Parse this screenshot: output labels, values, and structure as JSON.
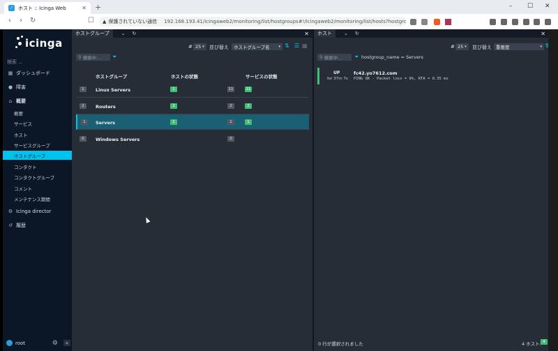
{
  "browser": {
    "tab_title": "ホスト :: Icinga Web",
    "new_tab": "+",
    "security_warning": "保護されていない通信",
    "url": "192.168.193.41/icingaweb2/monitoring/list/hostgroups#!/icingaweb2/monitoring/list/hosts?hostgroup_nam...",
    "window_minimize": "–",
    "window_maximize": "☐",
    "window_close": "✕",
    "back": "‹",
    "forward": "›",
    "reload": "↻",
    "bookmark": "☐"
  },
  "sidebar": {
    "logo": "icinga",
    "search_placeholder": "検索 ...",
    "items": [
      {
        "label": "ダッシュボード",
        "icon": "dashboard-icon"
      },
      {
        "label": "障害",
        "icon": "problems-icon"
      },
      {
        "label": "概要",
        "icon": "overview-icon"
      }
    ],
    "sub_items": [
      "概要",
      "サービス",
      "ホスト",
      "サービスグループ",
      "ホストグループ",
      "コンタクト",
      "コンタクトグループ",
      "コメント",
      "メンテナンス期間"
    ],
    "active_sub": "ホストグループ",
    "items_after": [
      {
        "label": "Icinga director",
        "icon": "director-icon"
      },
      {
        "label": "履歴",
        "icon": "history-icon"
      }
    ],
    "user": "root"
  },
  "left_panel": {
    "tab_label": "ホストグループ",
    "limit_hash": "#",
    "limit_value": "25",
    "sort_label": "並び替え",
    "sort_value": "ホストグループ名",
    "search_placeholder": "検索中...",
    "columns": [
      "ホストグループ",
      "ホストの状態",
      "サービスの状態"
    ],
    "rows": [
      {
        "count": "1",
        "name": "Linux Servers",
        "host_green": "1",
        "svc_grey": "11",
        "svc_green": "11"
      },
      {
        "count": "2",
        "name": "Routers",
        "host_green": "2",
        "svc_grey": "2",
        "svc_green": "2"
      },
      {
        "count": "1",
        "name": "Servers",
        "host_green": "1",
        "svc_grey": "1",
        "svc_green": "1"
      },
      {
        "count": "0",
        "name": "Windows Servers",
        "host_green": "",
        "svc_grey": "0",
        "svc_green": ""
      }
    ]
  },
  "right_panel": {
    "tab_label": "ホスト",
    "limit_hash": "#",
    "limit_value": "25",
    "sort_label": "並び替え",
    "sort_value": "重要度",
    "search_placeholder": "検索中...",
    "filter": "hostgroup_name = Servers",
    "host": {
      "state": "UP",
      "duration": "for 37m 7s",
      "name": "fc42.yo7612.com",
      "output": "PING OK - Packet loss = 0%, RTA = 0.35 ms"
    },
    "footer_selected": "0 行が選択されました",
    "footer_count_label": "4 ホスト:",
    "footer_count_badge": "4"
  },
  "colors": {
    "accent": "#00c3ed",
    "ok": "#44bb77",
    "sidebar": "#0b1726",
    "panel": "#272d36"
  }
}
